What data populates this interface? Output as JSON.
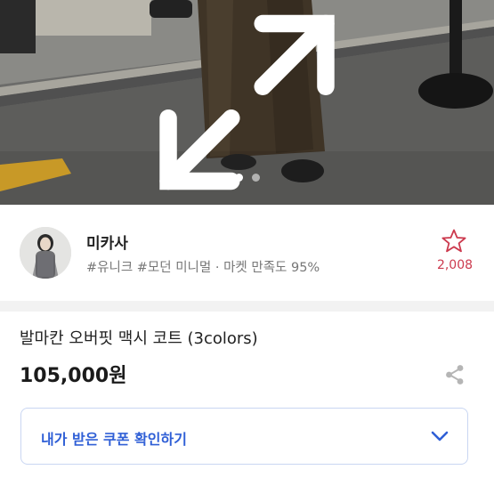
{
  "hero": {
    "total_images": 2,
    "active_index": 0
  },
  "seller": {
    "name": "미카사",
    "meta": "#유니크 #모던 미니멀 · 마켓 만족도 95%",
    "favorites": "2,008"
  },
  "product": {
    "title": "발마칸 오버핏 맥시 코트 (3colors)",
    "price": "105,000원"
  },
  "coupon": {
    "label": "내가 받은 쿠폰 확인하기"
  },
  "colors": {
    "accent_blue": "#2f5fd6",
    "favorite_red": "#cc3a4e"
  },
  "icons": [
    "expand-icon",
    "star-icon",
    "share-icon",
    "chevron-down-icon"
  ]
}
